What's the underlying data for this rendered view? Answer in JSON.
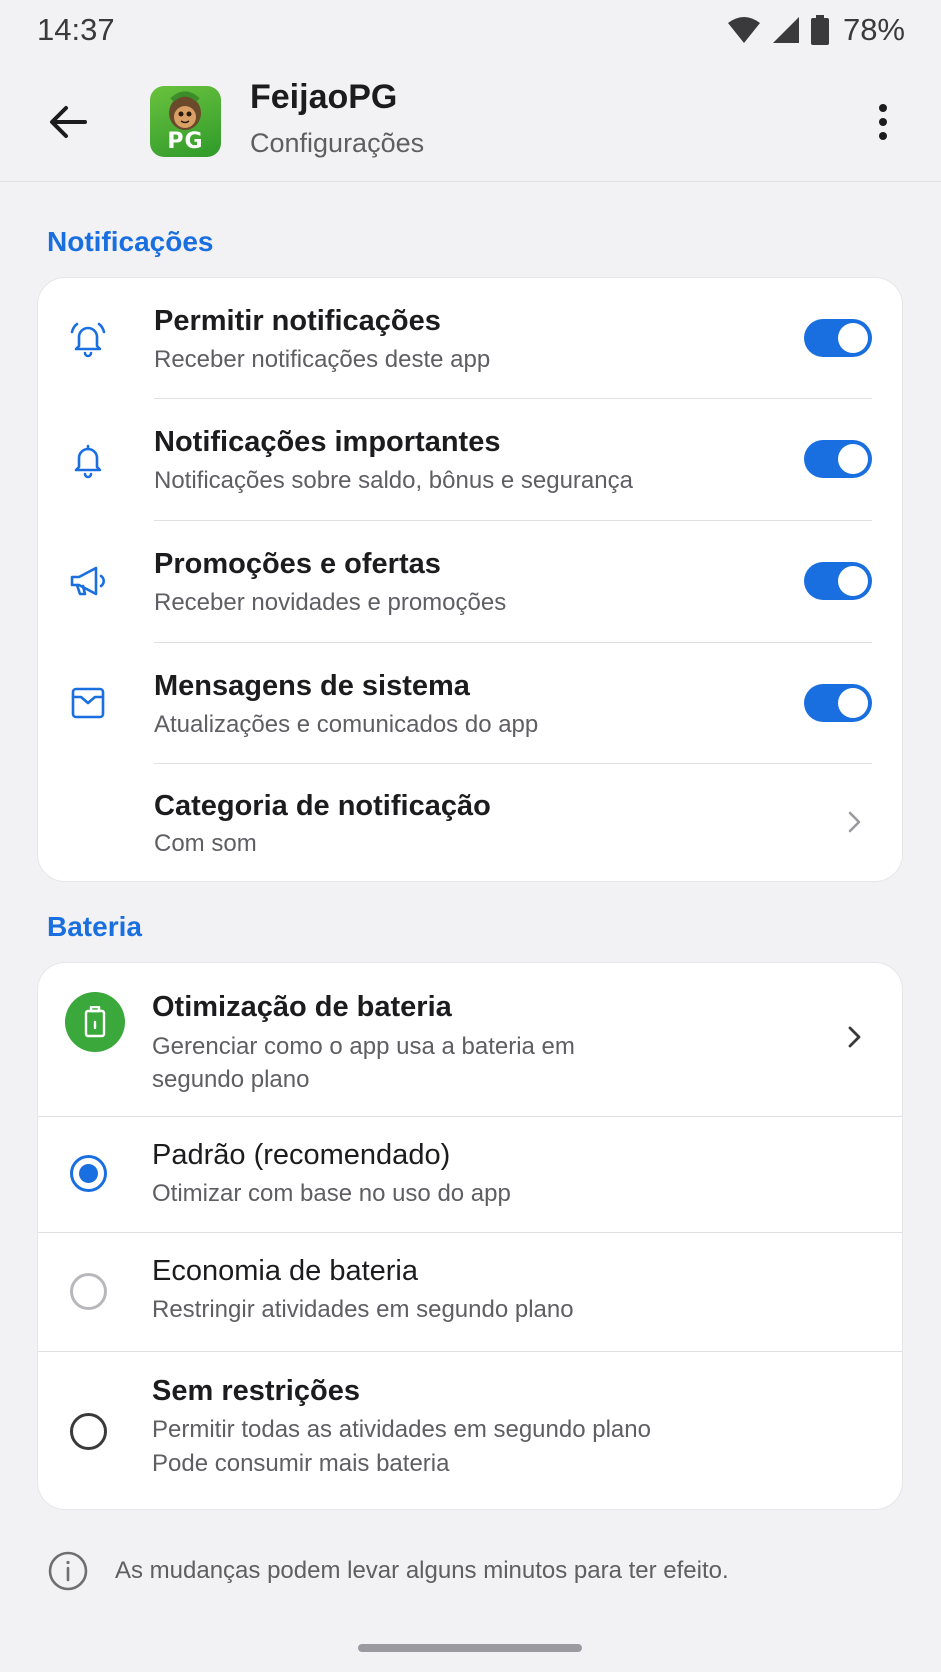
{
  "status_bar": {
    "time": "14:37",
    "battery": "78%"
  },
  "header": {
    "app_name": "FeijaoPG",
    "subtitle": "Configurações",
    "icon_text": "PG"
  },
  "notifications": {
    "section_title": "Notificações",
    "items": [
      {
        "title": "Permitir notificações",
        "subtitle": "Receber notificações deste app",
        "enabled": true,
        "icon": "bell-ringing-icon"
      },
      {
        "title": "Notificações importantes",
        "subtitle": "Notificações sobre saldo, bônus e segurança",
        "enabled": true,
        "icon": "bell-icon"
      },
      {
        "title": "Promoções e ofertas",
        "subtitle": "Receber novidades e promoções",
        "enabled": true,
        "icon": "megaphone-icon"
      },
      {
        "title": "Mensagens de sistema",
        "subtitle": "Atualizações e comunicados do app",
        "enabled": true,
        "icon": "inbox-icon"
      }
    ],
    "category": {
      "title": "Categoria de notificação",
      "subtitle": "Com som"
    }
  },
  "battery": {
    "section_title": "Bateria",
    "optimization": {
      "title": "Otimização de bateria",
      "subtitle_line1": "Gerenciar como o app usa a bateria em",
      "subtitle_line2": "segundo plano"
    },
    "options": [
      {
        "title": "Padrão (recomendado)",
        "subtitle": "Otimizar com base no uso do app",
        "selected": true
      },
      {
        "title": "Economia de bateria",
        "subtitle": "Restringir atividades em segundo plano",
        "selected": false
      },
      {
        "title": "Sem restrições",
        "subtitle_line1": "Permitir todas as atividades em segundo plano",
        "subtitle_line2": "Pode consumir mais bateria",
        "selected": false
      }
    ]
  },
  "footer": {
    "note": "As mudanças podem levar alguns minutos para ter efeito."
  },
  "colors": {
    "accent": "#1a6fe0",
    "battery_green": "#3aa83a"
  }
}
